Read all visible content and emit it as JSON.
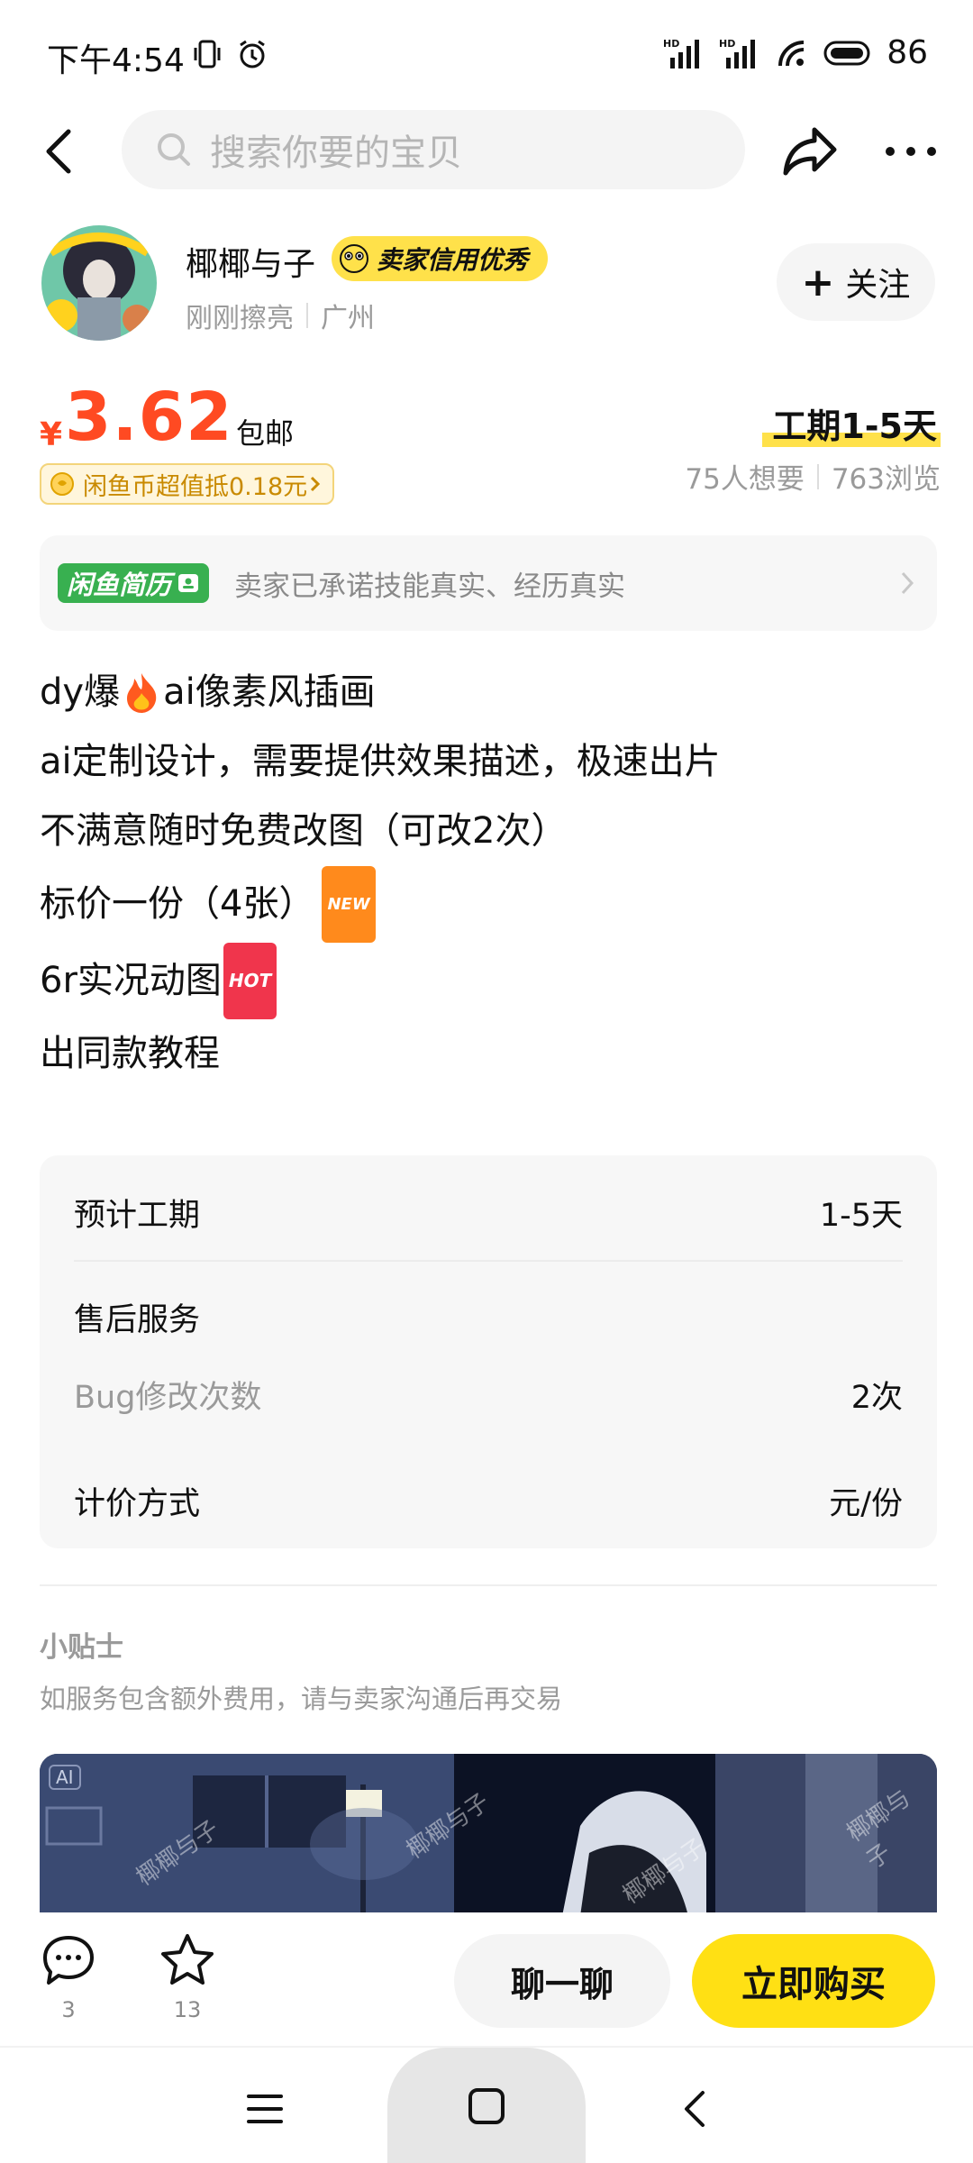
{
  "status_bar": {
    "time": "下午4:54",
    "battery": "86",
    "icons": [
      "vibrate-icon",
      "alarm-icon",
      "hd-signal-icon",
      "hd-signal-icon",
      "wifi-icon",
      "battery-icon"
    ]
  },
  "nav": {
    "search_placeholder": "搜索你要的宝贝",
    "icons": [
      "back-icon",
      "search-icon",
      "share-icon",
      "more-icon"
    ]
  },
  "seller": {
    "name": "椰椰与子",
    "credit_badge": "卖家信用优秀",
    "last_active": "刚刚擦亮",
    "location": "广州",
    "follow_label": "关注"
  },
  "price": {
    "currency": "¥",
    "amount": "3.62",
    "shipping": "包邮",
    "coin_discount": "闲鱼币超值抵0.18元",
    "period": "工期1-5天",
    "wants": "75人想要",
    "views": "763浏览"
  },
  "resume": {
    "tag": "闲鱼简历",
    "text": "卖家已承诺技能真实、经历真实"
  },
  "description": {
    "line1_a": "dy爆",
    "line1_b": "ai像素风插画",
    "line2": "ai定制设计，需要提供效果描述，极速出片",
    "line3": "不满意随时免费改图（可改2次）",
    "line4": "标价一份（4张）",
    "line4_badge": "NEW",
    "line5": "6r实况动图",
    "line5_badge": "HOT",
    "line6": "出同款教程"
  },
  "service": {
    "period_label": "预计工期",
    "period_value": "1-5天",
    "after_sales_label": "售后服务",
    "bug_label": "Bug修改次数",
    "bug_value": "2次",
    "pricing_label": "计价方式",
    "pricing_value": "元/份"
  },
  "tips": {
    "title": "小贴士",
    "text": "如服务包含额外费用，请与卖家沟通后再交易"
  },
  "preview": {
    "ai_tag": "AI",
    "watermark": "椰椰与子"
  },
  "actions": {
    "comments": "3",
    "favorites": "13",
    "chat_label": "聊一聊",
    "buy_label": "立即购买"
  },
  "colors": {
    "price": "#ff4a22",
    "accent_yellow": "#ffe014",
    "resume_green": "#38b050"
  }
}
